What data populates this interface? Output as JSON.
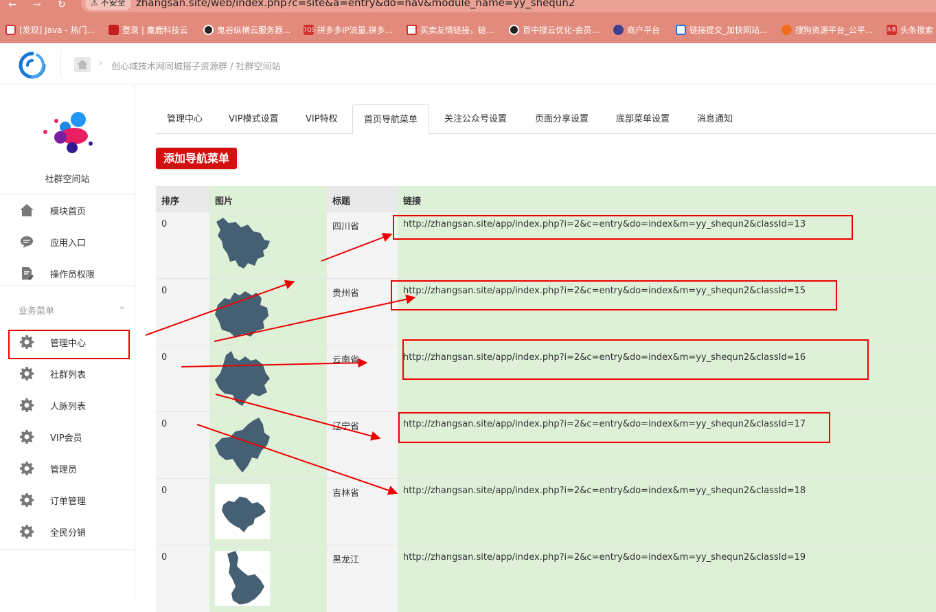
{
  "browser": {
    "insecure_label": "不安全",
    "url": "zhangsan.site/web/index.php?c=site&a=entry&do=nav&module_name=yy_shequn2",
    "bookmarks": [
      {
        "label": "[发现] Java - 热门...",
        "icon": "square-icon"
      },
      {
        "label": "登录 | 麋鹿科技云",
        "icon": "ghost-icon"
      },
      {
        "label": "鬼谷纵横云服务器...",
        "icon": "globe-icon"
      },
      {
        "label": "拼多多IP流量,拼多...",
        "icon": "q7-icon"
      },
      {
        "label": "买卖友情链接，链...",
        "icon": "checkbox-icon"
      },
      {
        "label": "百中搜云优化-会员...",
        "icon": "globe-icon"
      },
      {
        "label": "商户平台",
        "icon": "eye-icon"
      },
      {
        "label": "链接提交_加快网站...",
        "icon": "baidu-icon"
      },
      {
        "label": "搜狗资源平台_公平...",
        "icon": "sogou-icon"
      },
      {
        "label": "头条搜索",
        "icon": "toutiao-icon"
      }
    ]
  },
  "header": {
    "breadcrumb": "创心域技术网同城搭子资源群 / 社群空间站"
  },
  "sidebar": {
    "brand_name": "社群空间站",
    "top_items": [
      {
        "label": "模块首页",
        "icon": "home-icon"
      },
      {
        "label": "应用入口",
        "icon": "chat-icon"
      },
      {
        "label": "操作员权限",
        "icon": "document-edit-icon"
      }
    ],
    "section_title": "业务菜单",
    "business_items": [
      {
        "label": "管理中心",
        "icon": "gear-icon"
      },
      {
        "label": "社群列表",
        "icon": "gear-icon"
      },
      {
        "label": "人脉列表",
        "icon": "gear-icon"
      },
      {
        "label": "VIP会员",
        "icon": "gear-icon"
      },
      {
        "label": "管理员",
        "icon": "gear-icon"
      },
      {
        "label": "订单管理",
        "icon": "gear-icon"
      },
      {
        "label": "全民分销",
        "icon": "gear-icon"
      }
    ]
  },
  "tabs": [
    {
      "label": "管理中心",
      "active": false
    },
    {
      "label": "VIP模式设置",
      "active": false
    },
    {
      "label": "VIP特权",
      "active": false
    },
    {
      "label": "首页导航菜单",
      "active": true
    },
    {
      "label": "关注公众号设置",
      "active": false
    },
    {
      "label": "页面分享设置",
      "active": false
    },
    {
      "label": "底部菜单设置",
      "active": false
    },
    {
      "label": "消息通知",
      "active": false
    }
  ],
  "add_button": "添加导航菜单",
  "table": {
    "columns": [
      "排序",
      "图片",
      "标题",
      "链接"
    ],
    "rows": [
      {
        "sort": "0",
        "title": "四川省",
        "link": "http://zhangsan.site/app/index.php?i=2&c=entry&do=index&m=yy_shequn2&classId=13",
        "image": "sichuan-map"
      },
      {
        "sort": "0",
        "title": "贵州省",
        "link": "http://zhangsan.site/app/index.php?i=2&c=entry&do=index&m=yy_shequn2&classId=15",
        "image": "guizhou-map"
      },
      {
        "sort": "0",
        "title": "云南省",
        "link": "http://zhangsan.site/app/index.php?i=2&c=entry&do=index&m=yy_shequn2&classId=16",
        "image": "yunnan-map"
      },
      {
        "sort": "0",
        "title": "辽宁省",
        "link": "http://zhangsan.site/app/index.php?i=2&c=entry&do=index&m=yy_shequn2&classId=17",
        "image": "liaoning-map"
      },
      {
        "sort": "0",
        "title": "吉林省",
        "link": "http://zhangsan.site/app/index.php?i=2&c=entry&do=index&m=yy_shequn2&classId=18",
        "image": "jilin-map"
      },
      {
        "sort": "0",
        "title": "黑龙江",
        "link": "http://zhangsan.site/app/index.php?i=2&c=entry&do=index&m=yy_shequn2&classId=19",
        "image": "heilongjiang-map"
      }
    ]
  },
  "colors": {
    "browser_chrome": "#e28a7b",
    "add_button": "#d40f0f",
    "annotation_red": "#e00000",
    "column_green": "#dff0d8",
    "map_fill": "#455f73"
  }
}
